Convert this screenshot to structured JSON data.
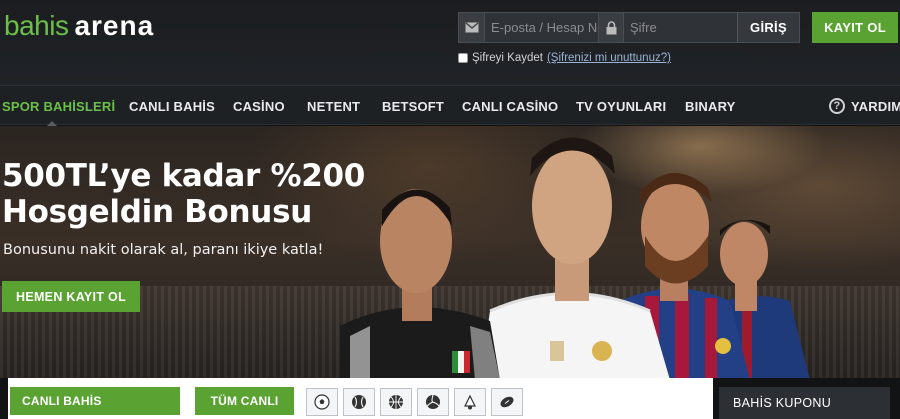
{
  "header": {
    "logo": {
      "part1": "bahis",
      "part2": "arena"
    },
    "login": {
      "email_placeholder": "E-posta / Hesap No",
      "password_placeholder": "Şifre",
      "submit_label": "GİRİŞ"
    },
    "remember": {
      "label": "Şifreyi Kaydet",
      "forgot_link": "(Şifrenizi mi unuttunuz?)"
    },
    "register_label": "KAYIT OL"
  },
  "nav": {
    "items": [
      {
        "label": "SPOR BAHİSLERİ",
        "active": true
      },
      {
        "label": "CANLI BAHİS"
      },
      {
        "label": "CASİNO"
      },
      {
        "label": "NETENT"
      },
      {
        "label": "BETSOFT"
      },
      {
        "label": "CANLI CASİNO"
      },
      {
        "label": "TV OYUNLARI"
      },
      {
        "label": "BINARY"
      }
    ],
    "help_label": "YARDIM"
  },
  "hero": {
    "title_line1": "500TL’ye kadar %200",
    "title_line2": "Hosgeldin Bonusu",
    "subtitle": "Bonusunu nakit olarak al, paranı ikiye katla!",
    "cta_label": "HEMEN KAYIT OL"
  },
  "bottom": {
    "live_bets_label": "CANLI BAHİS",
    "all_live_label": "TÜM CANLI",
    "sports": [
      "soccer-ball-icon",
      "baseball-icon",
      "basketball-icon",
      "volleyball-icon",
      "badminton-icon",
      "american-football-icon"
    ],
    "coupon_label": "BAHİS KUPONU"
  },
  "colors": {
    "accent_green": "#5aa332",
    "logo_green": "#6cc04a",
    "header_bg": "#1e2124"
  }
}
